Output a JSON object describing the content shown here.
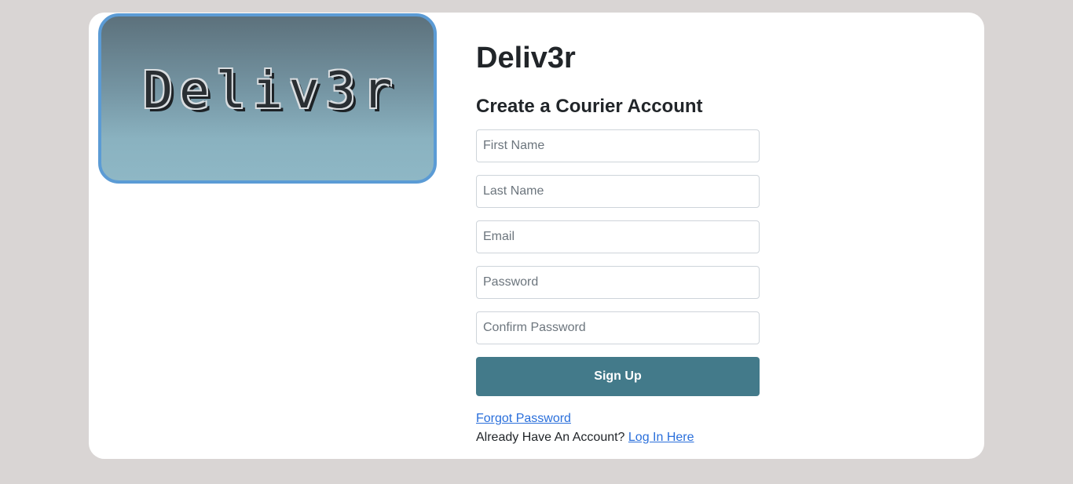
{
  "logo": {
    "text": "Deliv3r"
  },
  "brand": {
    "title": "Deliv3r"
  },
  "form": {
    "heading": "Create a Courier Account",
    "fields": {
      "first_name": {
        "placeholder": "First Name",
        "value": ""
      },
      "last_name": {
        "placeholder": "Last Name",
        "value": ""
      },
      "email": {
        "placeholder": "Email",
        "value": ""
      },
      "password": {
        "placeholder": "Password",
        "value": ""
      },
      "confirm_password": {
        "placeholder": "Confirm Password",
        "value": ""
      }
    },
    "submit_label": "Sign Up"
  },
  "links": {
    "forgot_password": "Forgot Password",
    "already_account_text": "Already Have An Account?",
    "login_here": "Log In Here"
  },
  "colors": {
    "page_background": "#d9d5d4",
    "card_background": "#ffffff",
    "button": "#437a8a",
    "link": "#2a6fdb",
    "logo_border": "#5b9bd5"
  }
}
